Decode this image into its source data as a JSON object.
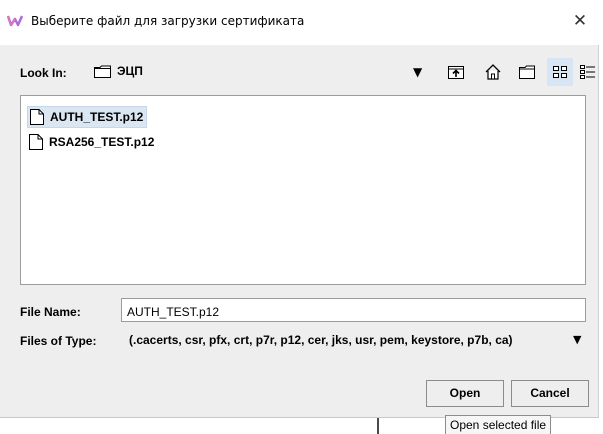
{
  "window": {
    "title": "Выберите файл для загрузки сертификата",
    "close_glyph": "✕"
  },
  "look_in": {
    "label": "Look In:",
    "value": "ЭЦП",
    "icon": "folder-icon",
    "arrow": "▼"
  },
  "toolbar": {
    "icons": [
      "up-one-level-icon",
      "home-icon",
      "new-folder-icon",
      "list-view-icon",
      "details-view-icon"
    ],
    "active": "list-view-icon"
  },
  "file_list": {
    "items": [
      {
        "name": "AUTH_TEST.p12",
        "selected": true
      },
      {
        "name": "RSA256_TEST.p12",
        "selected": false
      }
    ]
  },
  "file_name": {
    "label": "File Name:",
    "value": "AUTH_TEST.p12"
  },
  "file_type": {
    "label": "Files of Type:",
    "value": "(.cacerts, csr, pfx, crt, p7r, p12, cer, jks, usr, pem, keystore, p7b, ca)",
    "arrow": "▼"
  },
  "buttons": {
    "open": "Open",
    "cancel": "Cancel"
  },
  "tooltip": {
    "text": "Open selected file"
  },
  "colors": {
    "dialog_bg": "#eeeeee",
    "selection_bg": "#dbe6f3",
    "app_icon_accent": "#b06bd6"
  }
}
